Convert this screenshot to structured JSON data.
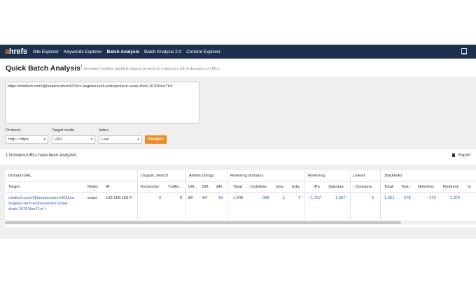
{
  "nav": {
    "logo_a": "a",
    "logo_rest": "hrefs",
    "items": [
      "Site Explorer",
      "Keywords Explorer",
      "Batch Analysis",
      "Batch Analysis 2.0",
      "Content Explorer"
    ],
    "active_index": 2,
    "right_icon": "monitor-icon"
  },
  "header": {
    "title": "Quick Batch Analysis",
    "title_sup": "i",
    "subtitle": "Generate multiple backlink reports at once by entering a list of domains or URLs"
  },
  "form": {
    "textarea_value": "https://medium.com/@lunaticsumon422/los-angeles-tech-entrepreneur-vivek-shah-16791fee71cf",
    "protocol_label": "Protocol",
    "protocol_value": "http + https",
    "target_mode_label": "Target mode",
    "target_mode_value": "URL",
    "index_label": "Index",
    "index_value": "Live",
    "analyse_label": "Analyse"
  },
  "status": {
    "text": "1 Domains/URLs have been analyzed.",
    "export_label": "Export"
  },
  "table": {
    "groups": {
      "domain_url": "Domain/URL",
      "organic_search": "Organic search",
      "ahrefs_ratings": "Ahrefs ratings",
      "referring_domains": "Referring domains",
      "referring": "Referring",
      "linked": "Linked",
      "backlinks": "Backlinks"
    },
    "columns": {
      "target": "Target",
      "mode": "Mode",
      "ip": "IP",
      "keywords": "Keywords",
      "traffic": "Traffic",
      "ur": "UR",
      "dr": "DR",
      "ar": "AR",
      "rd_total": "Total",
      "rd_dofollow": "Dofollow",
      "rd_gov": "Gov",
      "rd_edu": "Edu",
      "ref_ips": "IPs",
      "ref_subnets": "Subnets",
      "linked_domains": "Domains",
      "bl_total": "Total",
      "bl_text": "Text",
      "bl_nofollow": "Nofollow",
      "bl_redirect": "Redirect",
      "bl_more": "In"
    },
    "row": {
      "target_line1": "medium.com/@lunaticsumon422/los-",
      "target_line2": "angeles-tech-entrepreneur-vivek-",
      "target_line3": "shah-16791fee71cf +",
      "mode": "exact",
      "ip": "162.159.153.4",
      "keywords": "0",
      "traffic": "0",
      "ur": "80",
      "dr": "94",
      "ar": "66",
      "rd_total": "1,948",
      "rd_dofollow": "388",
      "rd_gov": "1",
      "rd_edu": "7",
      "ref_ips": "1,757",
      "ref_subnets": "1,507",
      "linked_domains": "0",
      "bl_total": "1,961",
      "bl_text": "578",
      "bl_nofollow": "173",
      "bl_redirect": "1,372"
    }
  },
  "colors": {
    "nav_bg": "#1e3050",
    "accent_orange": "#f08a1c",
    "link_blue": "#2b63b8",
    "panel_gray": "#efefef"
  }
}
